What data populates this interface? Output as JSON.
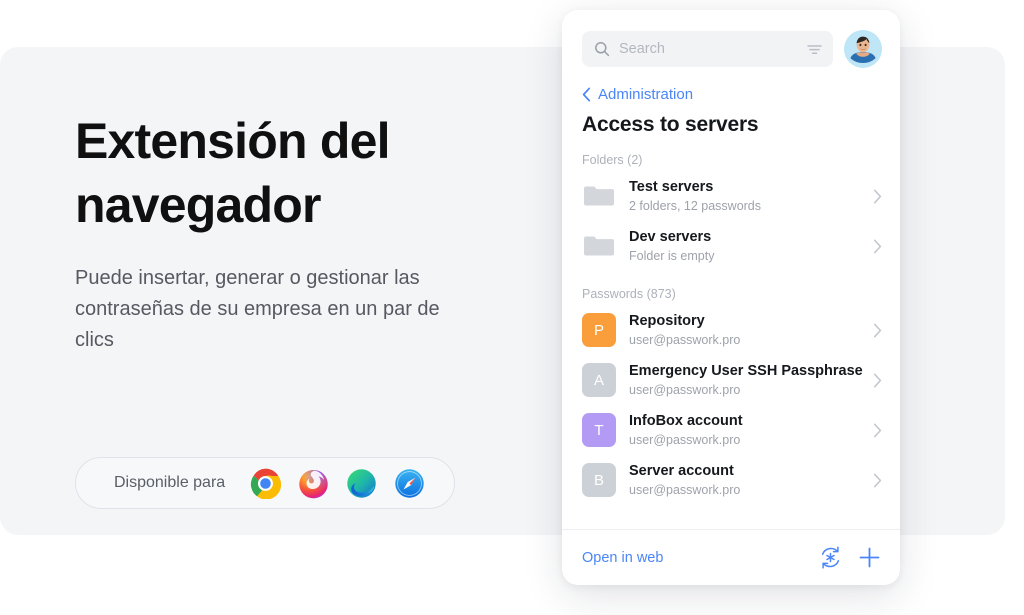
{
  "hero": {
    "title": "Extensión del\nnavegador",
    "subtitle": "Puede insertar, generar o gestionar las contraseñas de su empresa en un par de clics",
    "availability_label": "Disponible para",
    "browsers": [
      {
        "name": "chrome-icon",
        "label": "Google Chrome"
      },
      {
        "name": "firefox-icon",
        "label": "Mozilla Firefox"
      },
      {
        "name": "edge-icon",
        "label": "Microsoft Edge"
      },
      {
        "name": "safari-icon",
        "label": "Safari"
      }
    ]
  },
  "popup": {
    "search": {
      "placeholder": "Search",
      "value": "",
      "search_icon": "search-icon",
      "filter_icon": "filter-icon"
    },
    "avatar": {
      "icon": "avatar",
      "alt": "User avatar"
    },
    "breadcrumb": {
      "back_icon": "chevron-left-icon",
      "label": "Administration"
    },
    "title": "Access to servers",
    "sections": [
      {
        "header": "Folders (2)",
        "items": [
          {
            "icon": "folder-icon",
            "badge": "",
            "badge_color": "#d3d6db",
            "title": "Test servers",
            "subtitle": "2 folders, 12 passwords"
          },
          {
            "icon": "folder-icon",
            "badge": "",
            "badge_color": "#d3d6db",
            "title": "Dev servers",
            "subtitle": "Folder is empty"
          }
        ]
      },
      {
        "header": "Passwords (873)",
        "items": [
          {
            "icon": "password-badge",
            "badge": "P",
            "badge_color": "#fa9d3b",
            "title": "Repository",
            "subtitle": "user@passwork.pro"
          },
          {
            "icon": "password-badge",
            "badge": "A",
            "badge_color": "#ccd0d7",
            "title": "Emergency User SSH Passphrase",
            "subtitle": "user@passwork.pro"
          },
          {
            "icon": "password-badge",
            "badge": "T",
            "badge_color": "#b39af5",
            "title": "InfoBox account",
            "subtitle": "user@passwork.pro"
          },
          {
            "icon": "password-badge",
            "badge": "B",
            "badge_color": "#ccd0d7",
            "title": "Server account",
            "subtitle": "user@passwork.pro"
          }
        ]
      }
    ],
    "footer": {
      "open_in_web": "Open in web",
      "generate_icon": "generate-password-icon",
      "add_icon": "plus-icon"
    }
  },
  "colors": {
    "accent": "#4a86f7",
    "hero_bg": "#f4f5f7",
    "panel_bg": "#ffffff",
    "text_primary": "#15181d",
    "text_muted": "#9ea2aa"
  }
}
